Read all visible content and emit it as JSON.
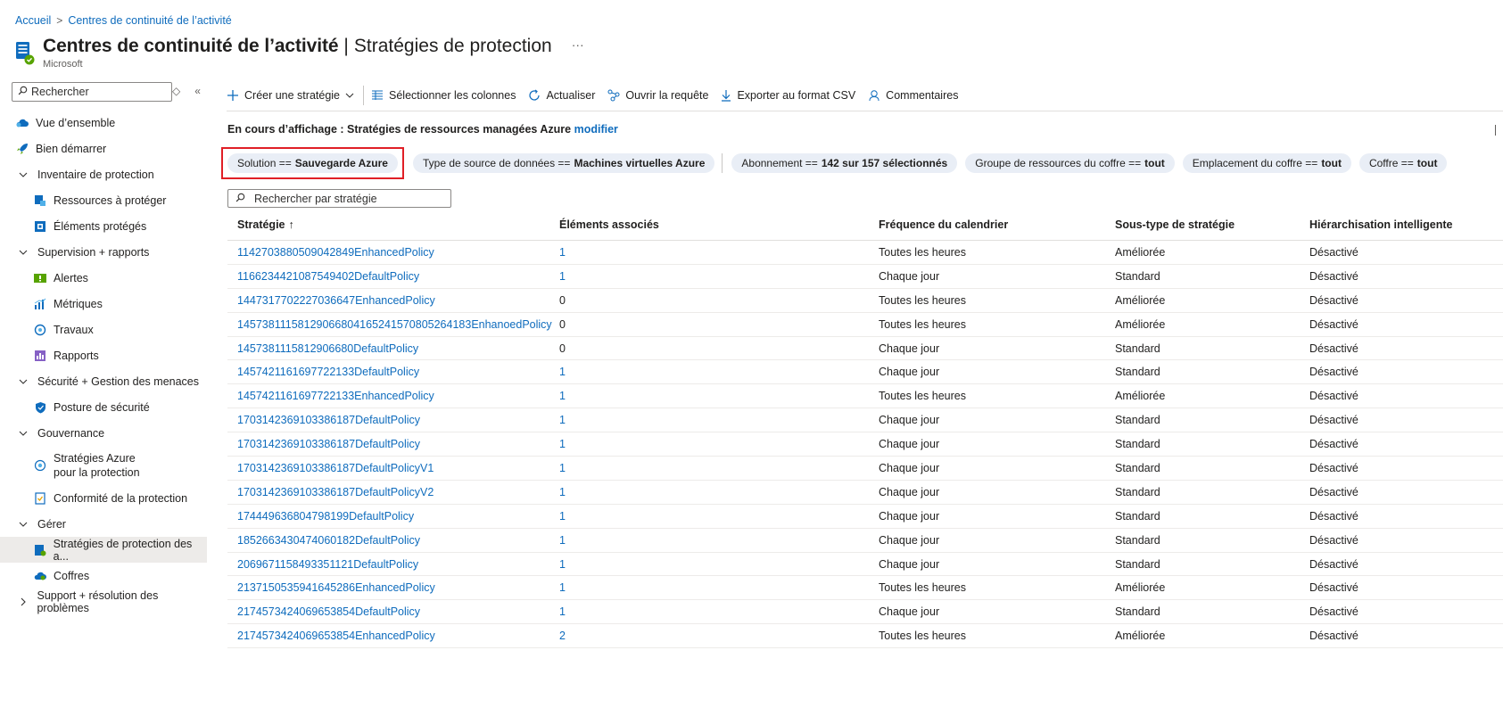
{
  "breadcrumb": {
    "home": "Accueil",
    "current": "Centres de continuité de l’activité"
  },
  "title": {
    "main": "Centres de continuité de l’activité",
    "separator": "|",
    "sub": "Stratégies de protection",
    "org": "Microsoft",
    "more": "···"
  },
  "sidebar": {
    "search_placeholder": "Rechercher",
    "items": [
      {
        "label": "Vue d’ensemble",
        "icon": "overview-cloud-icon"
      },
      {
        "label": "Bien démarrer",
        "icon": "rocket-icon"
      },
      {
        "label": "Inventaire de protection",
        "group": true
      },
      {
        "label": "Ressources à protéger",
        "icon": "resources-icon"
      },
      {
        "label": "Éléments protégés",
        "icon": "protected-items-icon"
      },
      {
        "label": "Supervision + rapports",
        "group": true
      },
      {
        "label": "Alertes",
        "icon": "alerts-icon"
      },
      {
        "label": "Métriques",
        "icon": "metrics-icon"
      },
      {
        "label": "Travaux",
        "icon": "jobs-icon"
      },
      {
        "label": "Rapports",
        "icon": "reports-icon"
      },
      {
        "label": "Sécurité + Gestion des menaces",
        "group": true
      },
      {
        "label": "Posture de sécurité",
        "icon": "shield-icon"
      },
      {
        "label": "Gouvernance",
        "group": true
      },
      {
        "label": "Stratégies Azure",
        "label2": "pour la protection",
        "icon": "azure-policy-icon"
      },
      {
        "label": "Conformité de la protection",
        "icon": "compliance-icon"
      },
      {
        "label": "Gérer",
        "group": true
      },
      {
        "label": "Stratégies de protection des a...",
        "icon": "policy-icon",
        "active": true
      },
      {
        "label": "Coffres",
        "icon": "vault-icon"
      },
      {
        "label": "Support + résolution des problèmes",
        "group": true,
        "collapsed": true
      }
    ]
  },
  "toolbar": {
    "create": "Créer une stratégie",
    "columns": "Sélectionner les colonnes",
    "refresh": "Actualiser",
    "query": "Ouvrir la requête",
    "export": "Exporter au format CSV",
    "feedback": "Commentaires"
  },
  "viewing": {
    "prefix": "En cours d’affichage : Stratégies de ressources managées Azure",
    "link": "modifier"
  },
  "filters": [
    {
      "key": "Solution ==",
      "value": "Sauvegarde Azure"
    },
    {
      "key": "Type de source de données ==",
      "value": "Machines virtuelles Azure"
    },
    {
      "key": "Abonnement ==",
      "value": "142 sur 157 sélectionnés"
    },
    {
      "key": "Groupe de ressources du coffre ==",
      "value": "tout"
    },
    {
      "key": "Emplacement du coffre ==",
      "value": "tout"
    },
    {
      "key": "Coffre ==",
      "value": "tout"
    }
  ],
  "grid_search_placeholder": "Rechercher par stratégie",
  "table": {
    "headers": [
      "Stratégie",
      "Éléments associés",
      "Fréquence du calendrier",
      "Sous-type de stratégie",
      "Hiérarchisation intelligente"
    ],
    "sort_indicator": "↑",
    "rows": [
      [
        "1142703880509042849EnhancedPolicy",
        "1",
        "Toutes les heures",
        "Améliorée",
        "Désactivé"
      ],
      [
        "1166234421087549402DefaultPolicy",
        "1",
        "Chaque jour",
        "Standard",
        "Désactivé"
      ],
      [
        "1447317702227036647EnhancedPolicy",
        "0",
        "Toutes les heures",
        "Améliorée",
        "Désactivé"
      ],
      [
        "145738111581290668041652415708052641​83EnhanoedPolicy",
        "0",
        "Toutes les heures",
        "Améliorée",
        "Désactivé"
      ],
      [
        "1457381115812906680DefaultPolicy",
        "0",
        "Chaque jour",
        "Standard",
        "Désactivé"
      ],
      [
        "1457421161697722133DefaultPolicy",
        "1",
        "Chaque jour",
        "Standard",
        "Désactivé"
      ],
      [
        "1457421161697722133EnhancedPolicy",
        "1",
        "Toutes les heures",
        "Améliorée",
        "Désactivé"
      ],
      [
        "1703142369103386187DefaultPolicy",
        "1",
        "Chaque jour",
        "Standard",
        "Désactivé"
      ],
      [
        "1703142369103386187DefaultPolicy",
        "1",
        "Chaque jour",
        "Standard",
        "Désactivé"
      ],
      [
        "1703142369103386187DefaultPolicyV1",
        "1",
        "Chaque jour",
        "Standard",
        "Désactivé"
      ],
      [
        "1703142369103386187DefaultPolicyV2",
        "1",
        "Chaque jour",
        "Standard",
        "Désactivé"
      ],
      [
        "174449636804798199DefaultPolicy",
        "1",
        "Chaque jour",
        "Standard",
        "Désactivé"
      ],
      [
        "1852663430474060182DefaultPolicy",
        "1",
        "Chaque jour",
        "Standard",
        "Désactivé"
      ],
      [
        "2069671158493351121DefaultPolicy",
        "1",
        "Chaque jour",
        "Standard",
        "Désactivé"
      ],
      [
        "2137150535941645286EnhancedPolicy",
        "1",
        "Toutes les heures",
        "Améliorée",
        "Désactivé"
      ],
      [
        "2174573424069653854DefaultPolicy",
        "1",
        "Chaque jour",
        "Standard",
        "Désactivé"
      ],
      [
        "2174573424069653854EnhancedPolicy",
        "2",
        "Toutes les heures",
        "Améliorée",
        "Désactivé"
      ]
    ]
  },
  "colors": {
    "link": "#0f6cbd",
    "highlight": "#e01f26",
    "pill_bg": "#e9eef6",
    "active_nav": "#edebe9"
  }
}
